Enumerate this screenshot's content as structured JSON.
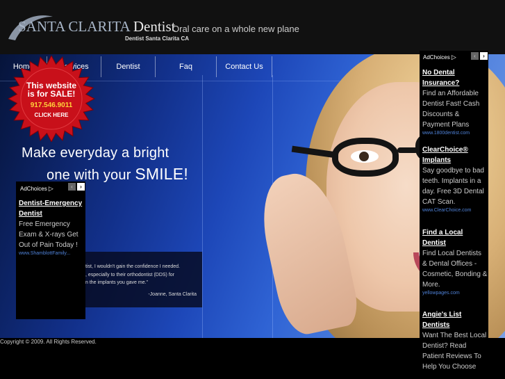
{
  "header": {
    "logo_part1": "SANTA CLARITA",
    "logo_part2": "Dentist",
    "tagline": "Oral care on a whole new plane",
    "subline": "Dentist Santa Clarita CA"
  },
  "nav": {
    "items": [
      {
        "label": "Home"
      },
      {
        "label": "Services"
      },
      {
        "label": "Dentist"
      },
      {
        "label": "Faq"
      },
      {
        "label": "Contact Us"
      }
    ]
  },
  "badge": {
    "line1": "This website",
    "line2": "is for SALE!",
    "phone": "917.546.9011",
    "cta": "CLICK HERE"
  },
  "hero": {
    "headline_line1": "Make everyday a bright",
    "headline_line2_start": "one with your ",
    "headline_line2_smile": "SMILE!"
  },
  "testimonial": {
    "line1": "tist, I wouldn't gain the confidence I needed.",
    "line2": ", especially to their orthodontist (DDS) for",
    "line3": "n the implants you gave me.\"",
    "author": "-Joanne, Santa Clarita"
  },
  "ad_left": {
    "adchoices": "AdChoices",
    "title": "Dentist-Emergency Dentist",
    "body": "Free Emergency Exam & X-rays Get Out of Pain Today !",
    "url": "www.ShamblottFamily..."
  },
  "ad_right": {
    "adchoices": "AdChoices",
    "ads": [
      {
        "title": "No Dental Insurance?",
        "body": "Find an Affordable Dentist Fast! Cash Discounts & Payment Plans",
        "url": "www.1800dentist.com"
      },
      {
        "title": "ClearChoice® Implants",
        "body": "Say goodbye to bad teeth. Implants in a day. Free 3D Dental CAT Scan.",
        "url": "www.ClearChoice.com"
      },
      {
        "title": "Find a Local Dentist",
        "body": "Find Local Dentists & Dental Offices - Cosmetic, Bonding & More.",
        "url": "yellowpages.com"
      },
      {
        "title": "Angie's List Dentists",
        "body": "Want The Best Local Dentist? Read Patient Reviews To Help You Choose",
        "url": ""
      }
    ]
  },
  "footer": {
    "copyright": "Copyright © 2009. All Rights Reserved."
  },
  "colors": {
    "badge_red": "#c8101a",
    "hero_blue": "#1d47b8",
    "ad_url_blue": "#4f82d8",
    "phone_yellow": "#ffd23a"
  }
}
